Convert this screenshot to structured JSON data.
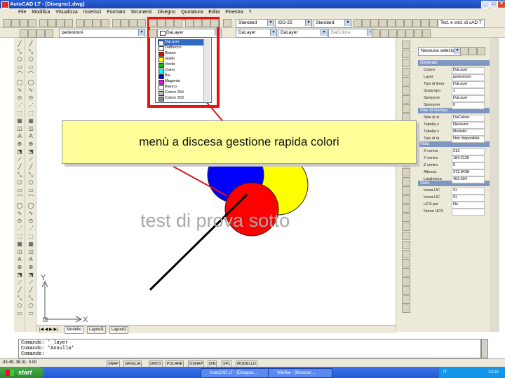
{
  "window": {
    "title": "AutoCAD LT - [Disegno1.dwg]",
    "controls": [
      "_",
      "□",
      "×"
    ]
  },
  "menu": [
    "File",
    "Modifica",
    "Visualizza",
    "Inserisci",
    "Formato",
    "Strumenti",
    "Disegno",
    "Quotatura",
    "Edita",
    "Finestra",
    "?"
  ],
  "toolbar_top": {
    "style_combo": "Standard",
    "iso_combo": "ISO-25",
    "std_combo": "Standard",
    "search_box": "Ted. e strd. di cAD T"
  },
  "toolbar_props": {
    "layer_combo": "pedestroni",
    "color_combo": "DaLayer",
    "linetype_combo": "DaLayer",
    "lineweight_combo": "DaLayer",
    "plotstyle_combo": "DaColore"
  },
  "color_dropdown": {
    "options": [
      {
        "label": "DaLayer",
        "color": "#ffffff",
        "selected": true
      },
      {
        "label": "DaBlocco",
        "color": "#ffffff",
        "selected": false
      },
      {
        "label": "Rosso",
        "color": "#ff0000",
        "selected": false
      },
      {
        "label": "Giallo",
        "color": "#ffff00",
        "selected": false
      },
      {
        "label": "Verde",
        "color": "#00c000",
        "selected": false
      },
      {
        "label": "Ciano",
        "color": "#00ffff",
        "selected": false
      },
      {
        "label": "Blu",
        "color": "#0000ff",
        "selected": false
      },
      {
        "label": "Magenta",
        "color": "#ff00ff",
        "selected": false
      },
      {
        "label": "Bianco",
        "color": "#ffffff",
        "selected": false
      },
      {
        "label": "Colore 254",
        "color": "#bbbbbb",
        "selected": false
      },
      {
        "label": "Colore 253",
        "color": "#888888",
        "selected": false
      }
    ]
  },
  "callout": {
    "text": "menù a discesa gestione rapida colori",
    "highlight_color": "#e81010"
  },
  "drawing": {
    "background_text": "test di prova sotto",
    "ucs_x_label": "X",
    "ucs_y_label": "Y",
    "colors": {
      "red": "#ff0000",
      "blue": "#0000ff",
      "yellow": "#ffff00",
      "line": "#000000"
    }
  },
  "layout_tabs": [
    "Modello",
    "Layout1",
    "Layout2"
  ],
  "properties": {
    "selection_combo": "Nessuna selezione",
    "sections": {
      "general": "Generale",
      "plot_style": "Stile di stampa",
      "view": "Vista",
      "misc": "Varie"
    },
    "general_rows": [
      {
        "key": "Colore",
        "value": "DaLayer"
      },
      {
        "key": "Layer",
        "value": "pedestroni"
      },
      {
        "key": "Tipo di linea",
        "value": "DaLayer"
      },
      {
        "key": "Scala tipo",
        "value": "1"
      },
      {
        "key": "Spessore",
        "value": "DaLayer"
      },
      {
        "key": "Spessore",
        "value": "0"
      }
    ],
    "plot_rows": [
      {
        "key": "Stile di st",
        "value": "DaColore"
      },
      {
        "key": "Tabella s",
        "value": "Nessuno"
      },
      {
        "key": "Tabella s",
        "value": "Modello"
      },
      {
        "key": "Tipo di ta",
        "value": "Non disponibile"
      }
    ],
    "view_rows": [
      {
        "key": "X centro",
        "value": "213"
      },
      {
        "key": "Y centro",
        "value": "184.2126"
      },
      {
        "key": "Z centro",
        "value": "0"
      },
      {
        "key": "Altezza",
        "value": "373.8438"
      },
      {
        "key": "Larghezza",
        "value": "453.594"
      }
    ],
    "misc_rows": [
      {
        "key": "Icona UC",
        "value": "Sì"
      },
      {
        "key": "Icona UC",
        "value": "Sì"
      },
      {
        "key": "UCS per",
        "value": "No"
      },
      {
        "key": "Nome UCS",
        "value": ""
      }
    ]
  },
  "command_line": {
    "lines": [
      "Comando: '_layer",
      "Comando: *Annulla*",
      "Comando:"
    ]
  },
  "status": {
    "coords": "-33.45, 38.31, 0.00",
    "buttons": [
      "SNAP",
      "GRIGLIA",
      "ORTO",
      "POLARE",
      "OSNAP",
      "DIN",
      "SPL",
      "MODELLO"
    ]
  },
  "taskbar": {
    "start_label": "start",
    "tasks": [
      "AutoCAD LT - [Disegno...",
      "WinRar - [Browser ..."
    ],
    "tray_lang": "IT",
    "clock": "13:15"
  }
}
